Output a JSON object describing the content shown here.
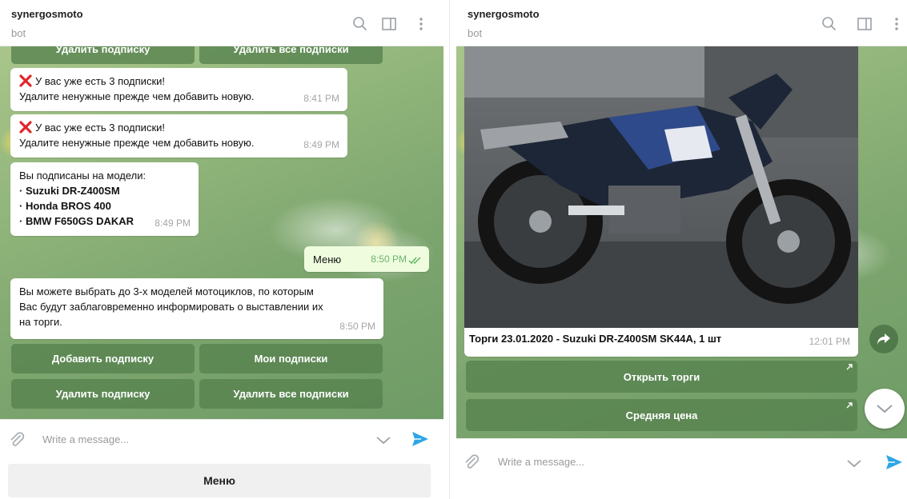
{
  "left": {
    "header": {
      "title": "synergosmoto",
      "subtitle": "bot"
    },
    "top_buttons": [
      "Удалить подписку",
      "Удалить все подписки"
    ],
    "messages": [
      {
        "line1": "У вас уже есть 3 подписки!",
        "line2": "Удалите ненужные прежде чем добавить новую.",
        "time": "8:41 PM"
      },
      {
        "line1": "У вас уже есть 3 подписки!",
        "line2": "Удалите ненужные прежде чем добавить новую.",
        "time": "8:49 PM"
      }
    ],
    "subscriptions": {
      "intro": "Вы подписаны на модели:",
      "models": [
        "· Suzuki DR-Z400SM",
        "· Honda BROS 400",
        "· BMW F650GS DAKAR"
      ],
      "time": "8:49 PM"
    },
    "outgoing": {
      "text": "Меню",
      "time": "8:50 PM"
    },
    "info": {
      "lines": [
        "Вы можете выбрать до 3-х моделей мотоциклов, по которым",
        "Вас будут заблаговременно информировать о выставлении их",
        "на торги."
      ],
      "time": "8:50 PM"
    },
    "keyboard": [
      [
        "Добавить подписку",
        "Мои подписки"
      ],
      [
        "Удалить подписку",
        "Удалить все подписки"
      ]
    ],
    "input_placeholder": "Write a message...",
    "menu_label": "Меню"
  },
  "right": {
    "header": {
      "title": "synergosmoto",
      "subtitle": "bot"
    },
    "post": {
      "caption": "Торги 23.01.2020 - Suzuki DR-Z400SM SK44A, 1 шт",
      "time": "12:01 PM"
    },
    "buttons": [
      "Открыть торги",
      "Средняя цена"
    ],
    "input_placeholder": "Write a message..."
  },
  "colors": {
    "send": "#2ea6e5",
    "keyboard_button": "#56824e",
    "check": "#5fb85e"
  },
  "icons": [
    "search-icon",
    "sidebar-toggle-icon",
    "more-vertical-icon",
    "attach-icon",
    "chevron-down-icon",
    "send-icon",
    "share-icon",
    "cross-icon",
    "double-check-icon",
    "link-arrow-icon",
    "photo"
  ]
}
